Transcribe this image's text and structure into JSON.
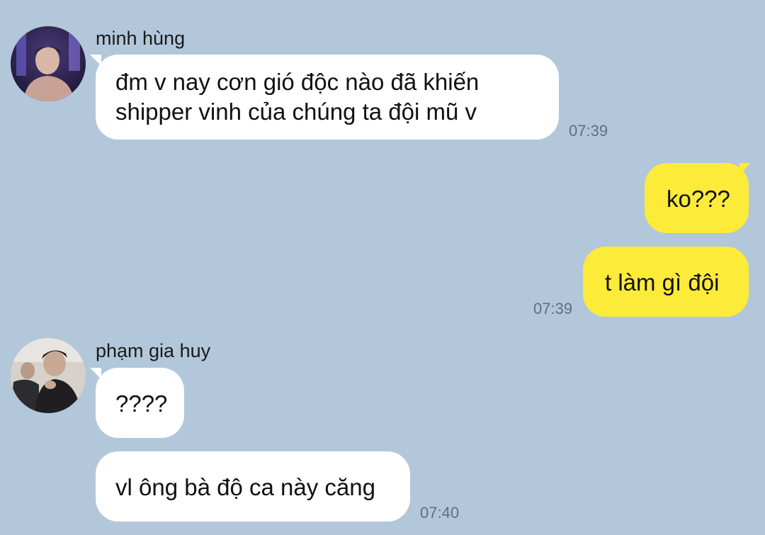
{
  "colors": {
    "background": "#b2c7da",
    "incoming_bubble": "#ffffff",
    "outgoing_bubble": "#fdeb3a",
    "timestamp": "#5f6f7f"
  },
  "messages": {
    "group1": {
      "sender": "minh hùng",
      "avatar": "avatar-photo-icon",
      "bubble1": {
        "line1": "đm v nay cơn gió độc nào đã khiến",
        "line2": "shipper vinh của chúng ta đội mũ v"
      },
      "time": "07:39"
    },
    "group2": {
      "bubble1": "ko???",
      "bubble2": "t làm gì đội",
      "time": "07:39"
    },
    "group3": {
      "sender": "phạm gia huy",
      "avatar": "avatar-photo-icon",
      "bubble1": "????",
      "bubble2": "vl ông bà độ ca này căng",
      "time": "07:40"
    }
  }
}
